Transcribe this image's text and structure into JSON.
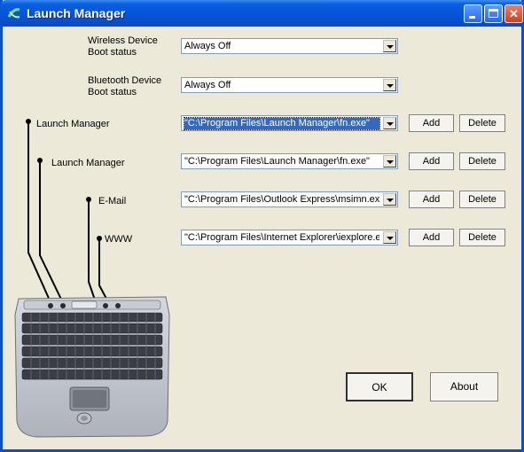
{
  "window": {
    "title": "Launch Manager",
    "buttons": {
      "minimize": "minimize",
      "maximize": "maximize",
      "close": "close"
    }
  },
  "wireless": {
    "label_line1": "Wireless Device",
    "label_line2": "Boot status",
    "value": "Always Off"
  },
  "bluetooth": {
    "label_line1": "Bluetooth Device",
    "label_line2": "Boot status",
    "value": "Always Off"
  },
  "keys": [
    {
      "label": "Launch Manager",
      "value": "\"C:\\Program Files\\Launch Manager\\fn.exe\"",
      "add": "Add",
      "delete": "Delete"
    },
    {
      "label": "Launch Manager",
      "value": "\"C:\\Program Files\\Launch Manager\\fn.exe\"",
      "add": "Add",
      "delete": "Delete"
    },
    {
      "label": "E-Mail",
      "value": "\"C:\\Program Files\\Outlook Express\\msimn.exe\"",
      "add": "Add",
      "delete": "Delete"
    },
    {
      "label": "WWW",
      "value": "\"C:\\Program Files\\Internet Explorer\\iexplore.exe\"",
      "add": "Add",
      "delete": "Delete"
    }
  ],
  "actions": {
    "ok": "OK",
    "about": "About"
  },
  "colors": {
    "titlebar": "#0654d8",
    "window_bg": "#ece9d8",
    "selection": "#316ac5",
    "close_button": "#d0401c"
  }
}
